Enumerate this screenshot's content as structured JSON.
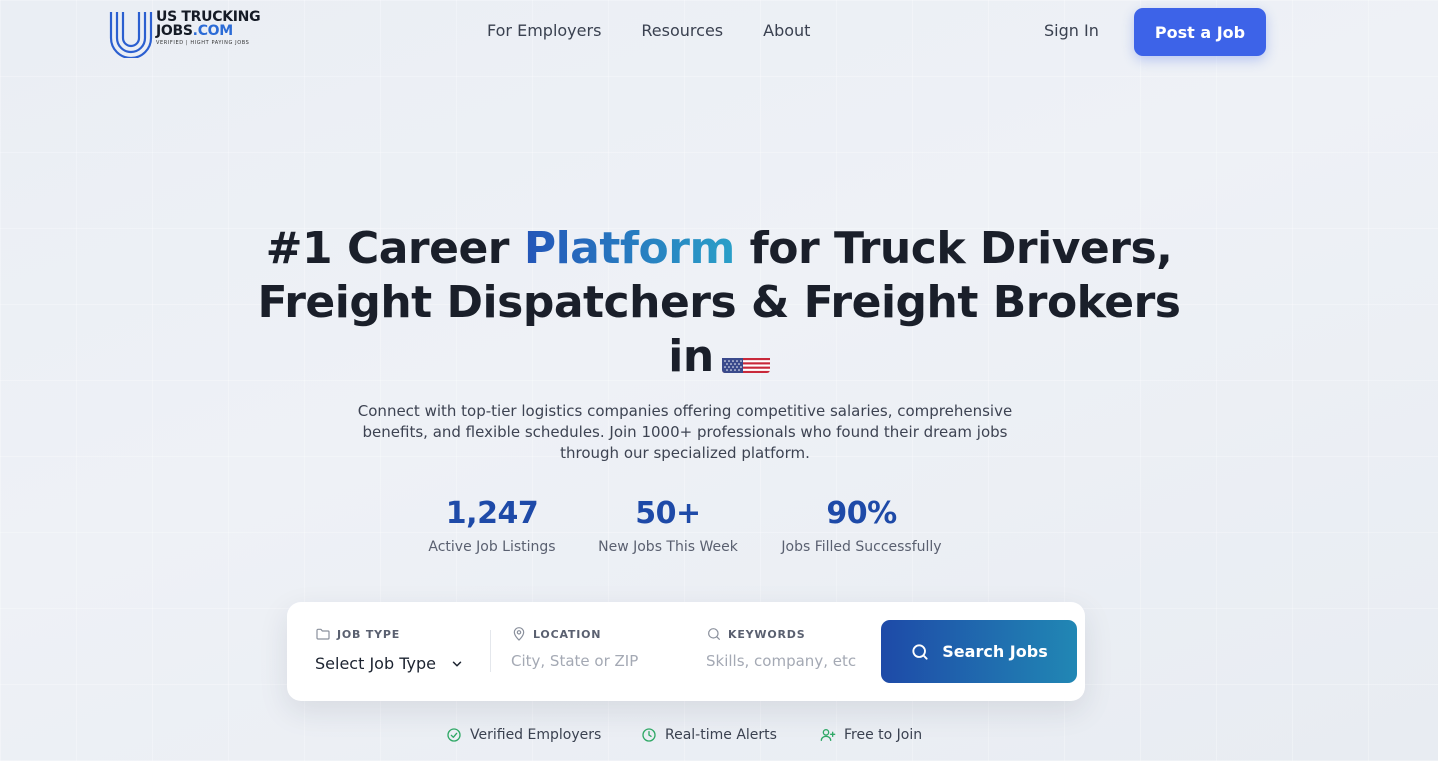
{
  "nav": {
    "logo": {
      "line1": "US TRUCKING",
      "line2_main": "JOBS",
      "line2_accent": ".COM",
      "tagline": "VERIFIED | HIGHT PAYING JOBS"
    },
    "links": [
      "For Employers",
      "Resources",
      "About"
    ],
    "sign_in": "Sign In",
    "post_job": "Post a Job"
  },
  "hero": {
    "title_part1": "#1 Career",
    "title_accent": "Platform",
    "title_part2": "for Truck Drivers,",
    "title_line2": "Freight Dispatchers & Freight Brokers",
    "title_line3": "in",
    "flag_icon": "us-flag-icon",
    "subtitle": "Connect with top-tier logistics companies offering competitive salaries, comprehensive benefits, and flexible schedules. Join 1000+ professionals who found their dream jobs through our specialized platform."
  },
  "stats": [
    {
      "value": "1,247",
      "label": "Active Job Listings"
    },
    {
      "value": "50+",
      "label": "New Jobs This Week"
    },
    {
      "value": "90%",
      "label": "Jobs Filled Successfully"
    }
  ],
  "search": {
    "job_type": {
      "label": "JOB TYPE",
      "value": "Select Job Type",
      "icon": "folder-icon"
    },
    "location": {
      "label": "LOCATION",
      "placeholder": "City, State or ZIP",
      "icon": "map-pin-icon"
    },
    "keywords": {
      "label": "KEYWORDS",
      "placeholder": "Skills, company, etc",
      "icon": "search-icon"
    },
    "button": "Search Jobs"
  },
  "features": [
    {
      "label": "Verified Employers",
      "icon": "check-circle-icon"
    },
    {
      "label": "Real-time Alerts",
      "icon": "clock-icon"
    },
    {
      "label": "Free to Join",
      "icon": "user-plus-icon"
    }
  ],
  "colors": {
    "primary": "#3d63e8",
    "accent_blue": "#1e4aa8",
    "accent_teal": "#2187b4",
    "success": "#2fa866"
  }
}
